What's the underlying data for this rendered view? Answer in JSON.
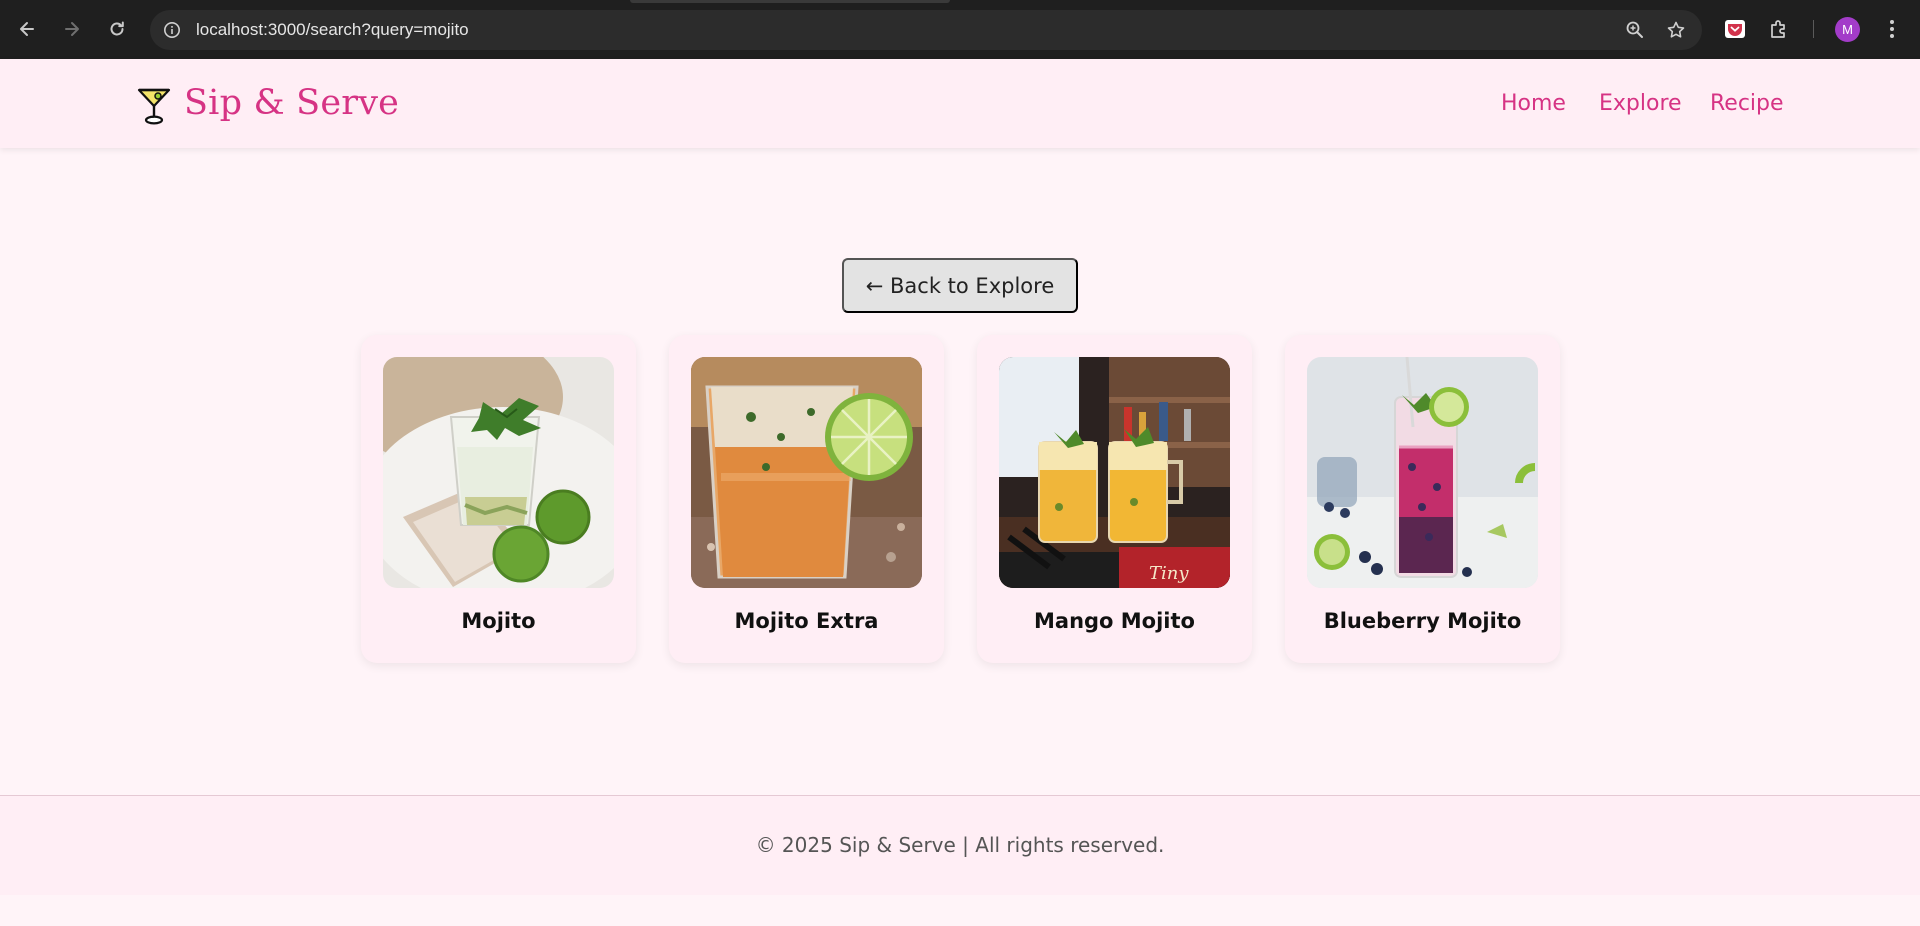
{
  "browser": {
    "url": "localhost:3000/search?query=mojito",
    "profile_initial": "M",
    "icons": [
      "back-arrow-icon",
      "forward-arrow-icon",
      "reload-icon",
      "site-info-icon",
      "zoom-icon",
      "bookmark-star-icon",
      "extension-pocket-icon",
      "extensions-puzzle-icon",
      "menu-kebab-icon"
    ]
  },
  "header": {
    "brand": "Sip & Serve",
    "logo_icon": "cocktail-glass-icon",
    "nav": {
      "home": "Home",
      "explore": "Explore",
      "recipe": "Recipe"
    }
  },
  "main": {
    "back_button": "← Back to Explore",
    "results": [
      {
        "name": "Mojito"
      },
      {
        "name": "Mojito Extra"
      },
      {
        "name": "Mango Mojito"
      },
      {
        "name": "Blueberry Mojito"
      }
    ]
  },
  "footer": {
    "copyright": "© 2025 Sip & Serve | All rights reserved."
  },
  "colors": {
    "accent": "#d63384",
    "page_bg": "#fff4f8",
    "header_bg": "#ffeef5",
    "button_bg": "#e3e3e3"
  }
}
